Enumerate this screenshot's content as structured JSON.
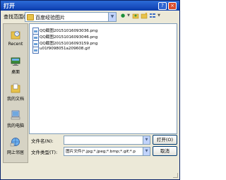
{
  "window": {
    "title": "打开",
    "help_label": "?",
    "close_label": "×"
  },
  "toolbar": {
    "look_in_label": "查找范围(I):",
    "look_in_value": "百度经验图片",
    "back_icon": "back-arrow-icon",
    "up_icon": "up-folder-icon",
    "new_folder_icon": "new-folder-icon",
    "view_icon": "view-menu-icon"
  },
  "places": [
    {
      "label": "Recent",
      "icon": "recent-icon"
    },
    {
      "label": "桌面",
      "icon": "desktop-icon"
    },
    {
      "label": "我的文档",
      "icon": "documents-icon"
    },
    {
      "label": "我的电脑",
      "icon": "computer-icon"
    },
    {
      "label": "网上邻居",
      "icon": "network-icon"
    }
  ],
  "files": [
    {
      "name": "QQ截图20151016093036.png"
    },
    {
      "name": "QQ截图20151016093046.png"
    },
    {
      "name": "QQ截图20151016093159.png"
    },
    {
      "name": "u01f9098051a209608.gif"
    }
  ],
  "footer": {
    "file_name_label": "文件名(N):",
    "file_name_value": "",
    "file_type_label": "文件类型(T):",
    "file_type_value": "图片文件(*.jpg;*.jpeg;*.bmp;*.gif;*.p",
    "open_label": "打开(O)",
    "cancel_label": "取消"
  }
}
